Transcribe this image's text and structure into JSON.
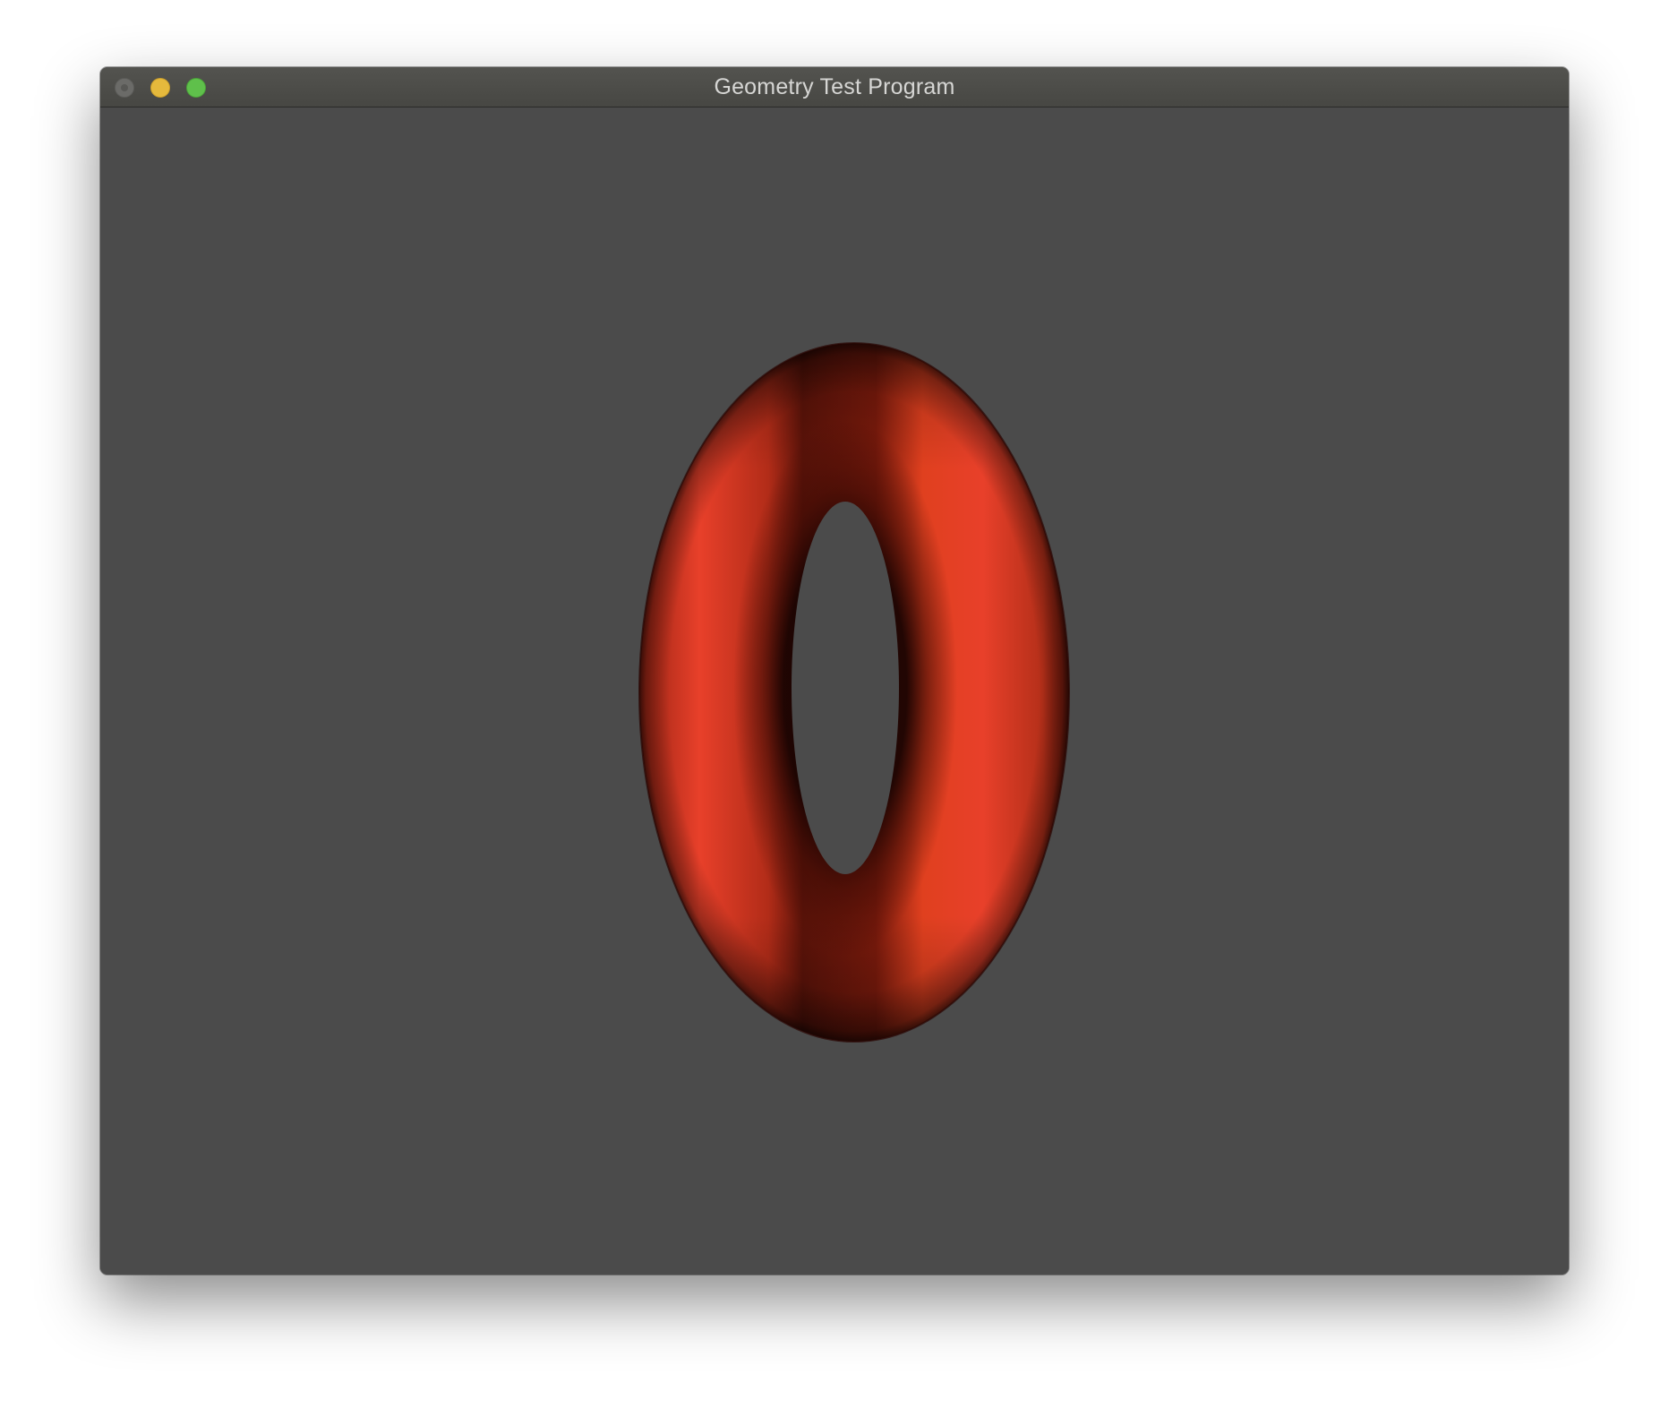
{
  "window": {
    "title": "Geometry Test Program",
    "buttons": {
      "close": "close-button",
      "minimize": "minimize-button",
      "zoom": "zoom-button"
    }
  },
  "scene": {
    "object": "torus",
    "background_color": "#4b4b4b",
    "object_color": "#e8402a",
    "shadow_color": "#5a1008"
  }
}
